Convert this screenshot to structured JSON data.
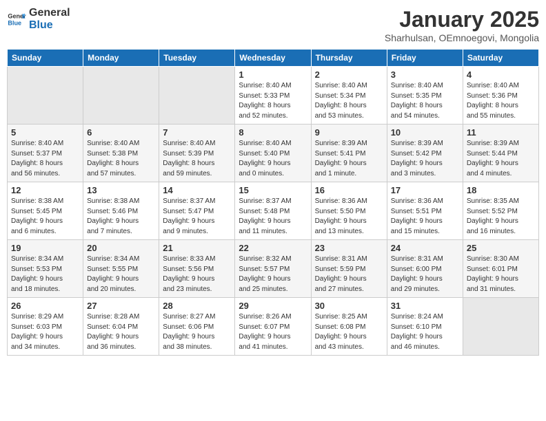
{
  "header": {
    "logo_line1": "General",
    "logo_line2": "Blue",
    "month": "January 2025",
    "location": "Sharhulsan, OEmnoegovi, Mongolia"
  },
  "weekdays": [
    "Sunday",
    "Monday",
    "Tuesday",
    "Wednesday",
    "Thursday",
    "Friday",
    "Saturday"
  ],
  "weeks": [
    [
      {
        "day": "",
        "info": ""
      },
      {
        "day": "",
        "info": ""
      },
      {
        "day": "",
        "info": ""
      },
      {
        "day": "1",
        "info": "Sunrise: 8:40 AM\nSunset: 5:33 PM\nDaylight: 8 hours\nand 52 minutes."
      },
      {
        "day": "2",
        "info": "Sunrise: 8:40 AM\nSunset: 5:34 PM\nDaylight: 8 hours\nand 53 minutes."
      },
      {
        "day": "3",
        "info": "Sunrise: 8:40 AM\nSunset: 5:35 PM\nDaylight: 8 hours\nand 54 minutes."
      },
      {
        "day": "4",
        "info": "Sunrise: 8:40 AM\nSunset: 5:36 PM\nDaylight: 8 hours\nand 55 minutes."
      }
    ],
    [
      {
        "day": "5",
        "info": "Sunrise: 8:40 AM\nSunset: 5:37 PM\nDaylight: 8 hours\nand 56 minutes."
      },
      {
        "day": "6",
        "info": "Sunrise: 8:40 AM\nSunset: 5:38 PM\nDaylight: 8 hours\nand 57 minutes."
      },
      {
        "day": "7",
        "info": "Sunrise: 8:40 AM\nSunset: 5:39 PM\nDaylight: 8 hours\nand 59 minutes."
      },
      {
        "day": "8",
        "info": "Sunrise: 8:40 AM\nSunset: 5:40 PM\nDaylight: 9 hours\nand 0 minutes."
      },
      {
        "day": "9",
        "info": "Sunrise: 8:39 AM\nSunset: 5:41 PM\nDaylight: 9 hours\nand 1 minute."
      },
      {
        "day": "10",
        "info": "Sunrise: 8:39 AM\nSunset: 5:42 PM\nDaylight: 9 hours\nand 3 minutes."
      },
      {
        "day": "11",
        "info": "Sunrise: 8:39 AM\nSunset: 5:44 PM\nDaylight: 9 hours\nand 4 minutes."
      }
    ],
    [
      {
        "day": "12",
        "info": "Sunrise: 8:38 AM\nSunset: 5:45 PM\nDaylight: 9 hours\nand 6 minutes."
      },
      {
        "day": "13",
        "info": "Sunrise: 8:38 AM\nSunset: 5:46 PM\nDaylight: 9 hours\nand 7 minutes."
      },
      {
        "day": "14",
        "info": "Sunrise: 8:37 AM\nSunset: 5:47 PM\nDaylight: 9 hours\nand 9 minutes."
      },
      {
        "day": "15",
        "info": "Sunrise: 8:37 AM\nSunset: 5:48 PM\nDaylight: 9 hours\nand 11 minutes."
      },
      {
        "day": "16",
        "info": "Sunrise: 8:36 AM\nSunset: 5:50 PM\nDaylight: 9 hours\nand 13 minutes."
      },
      {
        "day": "17",
        "info": "Sunrise: 8:36 AM\nSunset: 5:51 PM\nDaylight: 9 hours\nand 15 minutes."
      },
      {
        "day": "18",
        "info": "Sunrise: 8:35 AM\nSunset: 5:52 PM\nDaylight: 9 hours\nand 16 minutes."
      }
    ],
    [
      {
        "day": "19",
        "info": "Sunrise: 8:34 AM\nSunset: 5:53 PM\nDaylight: 9 hours\nand 18 minutes."
      },
      {
        "day": "20",
        "info": "Sunrise: 8:34 AM\nSunset: 5:55 PM\nDaylight: 9 hours\nand 20 minutes."
      },
      {
        "day": "21",
        "info": "Sunrise: 8:33 AM\nSunset: 5:56 PM\nDaylight: 9 hours\nand 23 minutes."
      },
      {
        "day": "22",
        "info": "Sunrise: 8:32 AM\nSunset: 5:57 PM\nDaylight: 9 hours\nand 25 minutes."
      },
      {
        "day": "23",
        "info": "Sunrise: 8:31 AM\nSunset: 5:59 PM\nDaylight: 9 hours\nand 27 minutes."
      },
      {
        "day": "24",
        "info": "Sunrise: 8:31 AM\nSunset: 6:00 PM\nDaylight: 9 hours\nand 29 minutes."
      },
      {
        "day": "25",
        "info": "Sunrise: 8:30 AM\nSunset: 6:01 PM\nDaylight: 9 hours\nand 31 minutes."
      }
    ],
    [
      {
        "day": "26",
        "info": "Sunrise: 8:29 AM\nSunset: 6:03 PM\nDaylight: 9 hours\nand 34 minutes."
      },
      {
        "day": "27",
        "info": "Sunrise: 8:28 AM\nSunset: 6:04 PM\nDaylight: 9 hours\nand 36 minutes."
      },
      {
        "day": "28",
        "info": "Sunrise: 8:27 AM\nSunset: 6:06 PM\nDaylight: 9 hours\nand 38 minutes."
      },
      {
        "day": "29",
        "info": "Sunrise: 8:26 AM\nSunset: 6:07 PM\nDaylight: 9 hours\nand 41 minutes."
      },
      {
        "day": "30",
        "info": "Sunrise: 8:25 AM\nSunset: 6:08 PM\nDaylight: 9 hours\nand 43 minutes."
      },
      {
        "day": "31",
        "info": "Sunrise: 8:24 AM\nSunset: 6:10 PM\nDaylight: 9 hours\nand 46 minutes."
      },
      {
        "day": "",
        "info": ""
      }
    ]
  ]
}
